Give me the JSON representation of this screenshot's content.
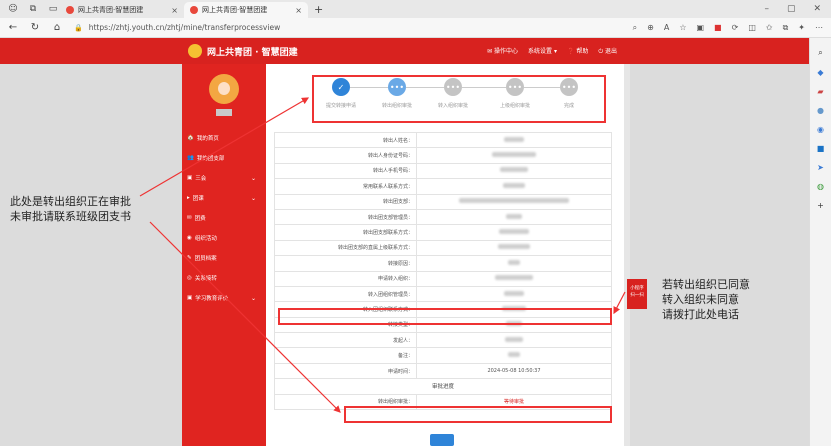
{
  "browser": {
    "tabs": [
      {
        "title": "网上共青团·智慧团建",
        "active": false
      },
      {
        "title": "网上共青团·智慧团建",
        "active": true
      }
    ],
    "url": "https://zhtj.youth.cn/zhtj/mine/transferprocessview",
    "new_tab": "+"
  },
  "header": {
    "title": "网上共青团 · 智慧团建",
    "links": [
      "✉ 操作中心",
      "系统设置 ▾",
      "❓ 帮助",
      "⏻ 退出"
    ]
  },
  "sidebar": {
    "items": [
      {
        "icon": "🏠",
        "label": "我的首页",
        "chevron": ""
      },
      {
        "icon": "👥",
        "label": "我的团支部",
        "chevron": ""
      },
      {
        "icon": "▣",
        "label": "三会",
        "chevron": "⌄"
      },
      {
        "icon": "▸",
        "label": "团课",
        "chevron": "⌄"
      },
      {
        "icon": "✉",
        "label": "团费",
        "chevron": ""
      },
      {
        "icon": "◉",
        "label": "组织活动",
        "chevron": ""
      },
      {
        "icon": "✎",
        "label": "团员档案",
        "chevron": ""
      },
      {
        "icon": "◎",
        "label": "关系接转",
        "chevron": ""
      },
      {
        "icon": "▣",
        "label": "学习教育评价",
        "chevron": "⌄"
      }
    ]
  },
  "steps": [
    {
      "label": "提交转接申请",
      "state": "done",
      "symbol": "✓"
    },
    {
      "label": "转出组织审批",
      "state": "cur",
      "symbol": "•••"
    },
    {
      "label": "转入组织审批",
      "state": "todo",
      "symbol": "•••"
    },
    {
      "label": "上级组织审批",
      "state": "todo",
      "symbol": "•••"
    },
    {
      "label": "完成",
      "state": "todo",
      "symbol": "•••"
    }
  ],
  "table": {
    "rows": [
      {
        "label": "转出人姓名：",
        "blur": 20
      },
      {
        "label": "转出人身份证号码：",
        "blur": 44
      },
      {
        "label": "转出人手机号码：",
        "blur": 28
      },
      {
        "label": "常用联系人联系方式：",
        "blur": 22
      },
      {
        "label": "转出团支部：",
        "blur": 110
      },
      {
        "label": "转出团支部管理员：",
        "blur": 16
      },
      {
        "label": "转出团支部联系方式：",
        "blur": 30
      },
      {
        "label": "转出团支部的直属上级联系方式：",
        "blur": 32
      },
      {
        "label": "转接原因：",
        "blur": 12
      },
      {
        "label": "申请转入组织：",
        "blur": 38
      },
      {
        "label": "转入团组织管理员：",
        "blur": 20
      },
      {
        "label": "转入团组织联系方式：",
        "blur": 24
      },
      {
        "label": "转接类型：",
        "blur": 16
      },
      {
        "label": "发起人：",
        "blur": 18
      },
      {
        "label": "备注：",
        "blur": 12
      },
      {
        "label": "申请时间：",
        "text": "2024-05-08 10:50:37"
      }
    ],
    "progress_title": "审批进度",
    "approval_label": "转出组织审批：",
    "approval_status": "等待审批"
  },
  "annotations": {
    "left_note": [
      "此处是转出组织正在审批",
      "未审批请联系班级团支书"
    ],
    "right_note": [
      "若转出组织已同意",
      "转入组织未同意",
      "请拨打此处电话"
    ],
    "badge": [
      "小程序",
      "扫一扫"
    ]
  },
  "colors": {
    "brand_red": "#d8221f",
    "step_blue": "#2f84d8",
    "mark_red": "#e33"
  }
}
